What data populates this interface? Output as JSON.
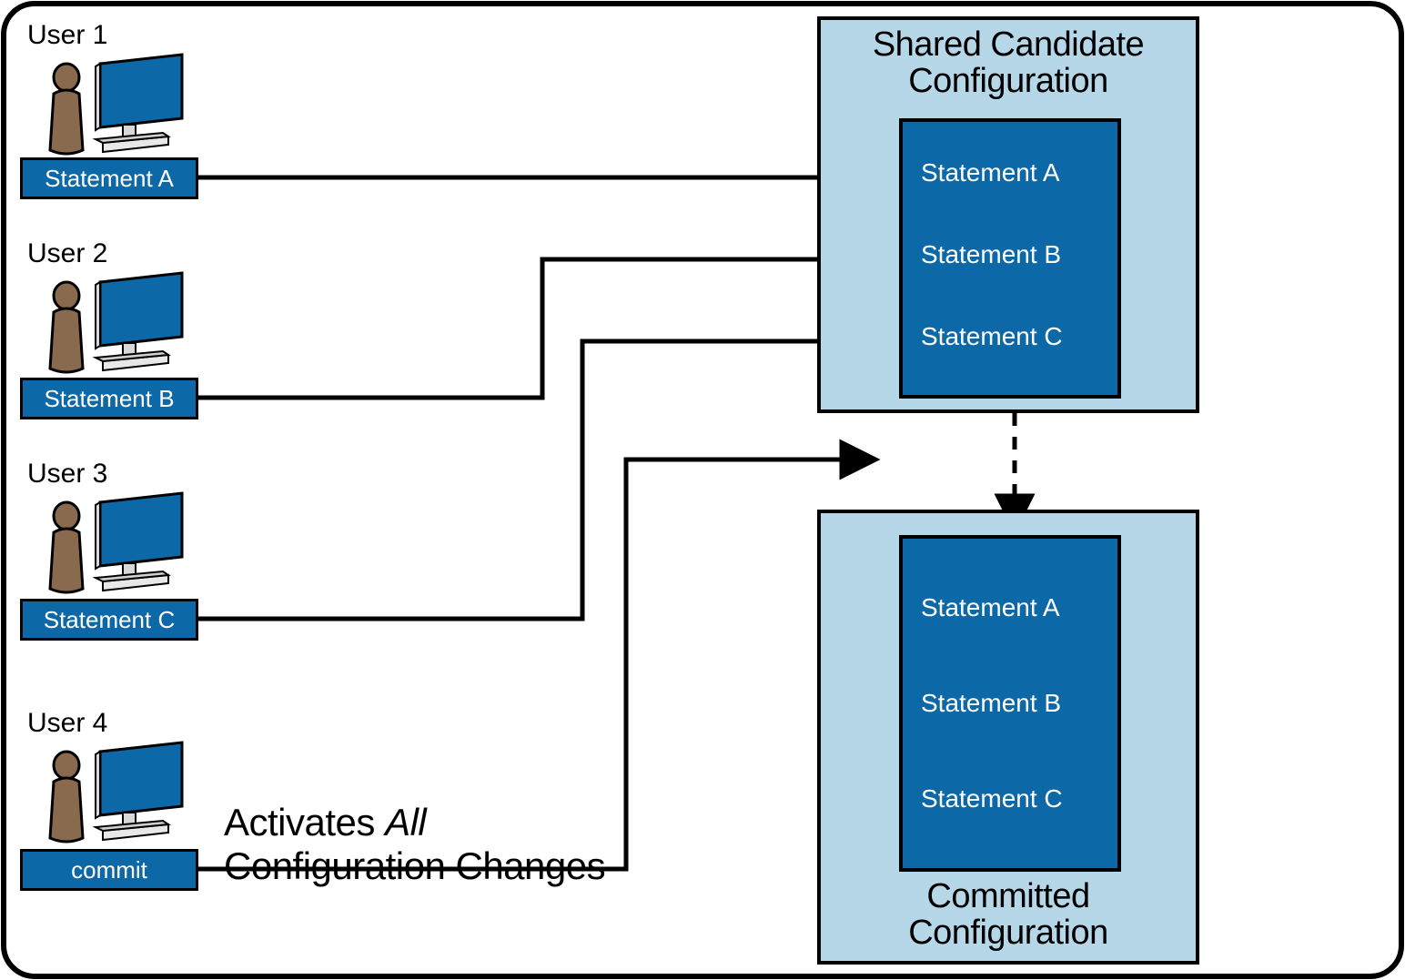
{
  "users": [
    {
      "label": "User 1",
      "statement": "Statement A"
    },
    {
      "label": "User 2",
      "statement": "Statement B"
    },
    {
      "label": "User 3",
      "statement": "Statement C"
    },
    {
      "label": "User 4",
      "statement": "commit"
    }
  ],
  "shared": {
    "title_line1": "Shared Candidate",
    "title_line2": "Configuration",
    "statements": [
      "Statement A",
      "Statement B",
      "Statement C"
    ]
  },
  "committed": {
    "title_line1": "Committed",
    "title_line2": "Configuration",
    "statements": [
      "Statement A",
      "Statement B",
      "Statement C"
    ]
  },
  "activates": {
    "line1_pre": "Activates ",
    "line1_ital": "All",
    "line2": "Configuration Changes"
  }
}
